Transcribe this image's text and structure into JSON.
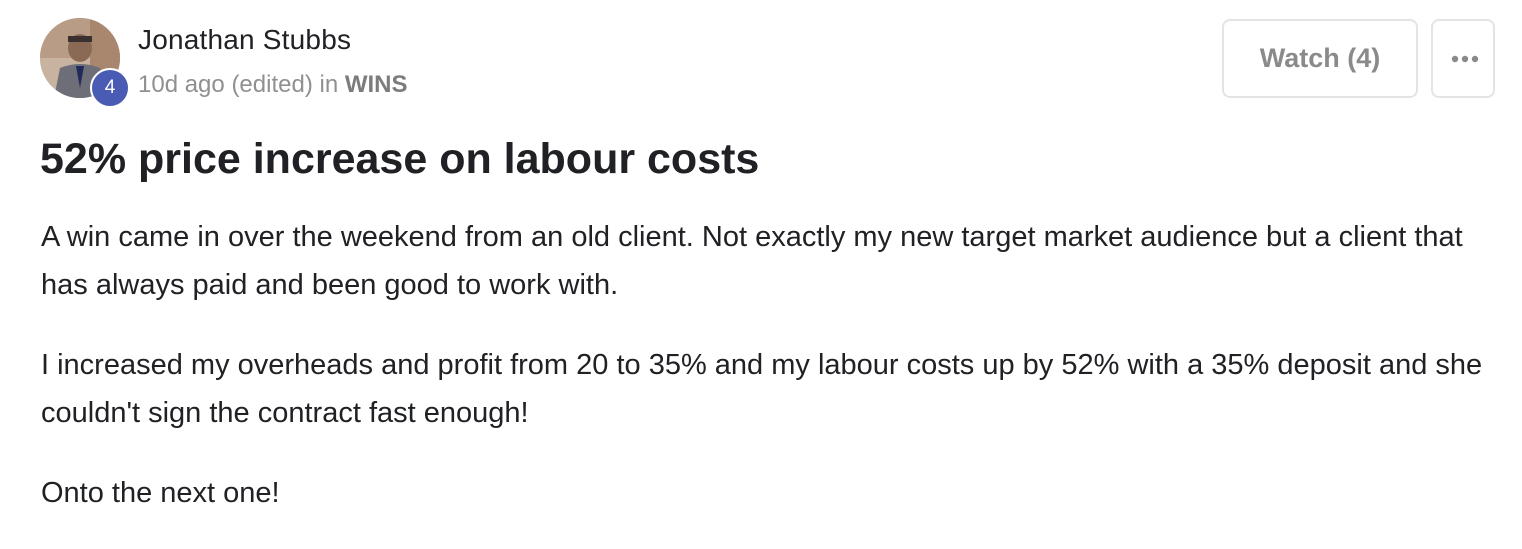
{
  "author": {
    "name": "Jonathan Stubbs",
    "level": "4",
    "avatar": "user-avatar-photo"
  },
  "meta": {
    "time": "10d ago",
    "edited": "(edited)",
    "in_label": "in",
    "category": "WINS"
  },
  "actions": {
    "watch_label": "Watch (4)",
    "more_icon": "ellipsis-icon"
  },
  "post": {
    "title": "52% price increase on labour costs",
    "paragraphs": [
      "A win came in over the weekend from an old client. Not exactly my new target market audience but a client that has always paid and been good to work with.",
      "I increased my overheads and profit from 20 to 35% and my labour costs up by 52% with a 35% deposit and she couldn't sign the contract fast enough!",
      "Onto the next one!"
    ]
  },
  "colors": {
    "badge": "#4a5bb3",
    "meta_text": "#909090",
    "border": "#e4e4e4"
  }
}
